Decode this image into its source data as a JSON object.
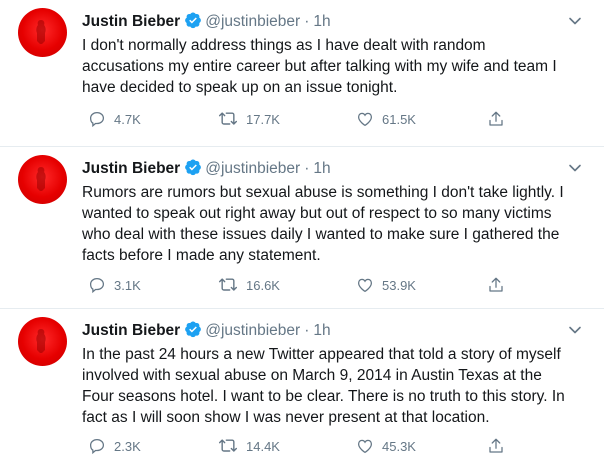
{
  "tweets": [
    {
      "name": "Justin Bieber",
      "handle": "@justinbieber",
      "separator": "·",
      "time": "1h",
      "text": "I don't normally address things as I have dealt with random\naccusations my entire career but after talking with my wife and team I\nhave decided to speak up on an issue tonight.",
      "replies": "4.7K",
      "retweets": "17.7K",
      "likes": "61.5K"
    },
    {
      "name": "Justin Bieber",
      "handle": "@justinbieber",
      "separator": "·",
      "time": "1h",
      "text": "Rumors are rumors but sexual abuse is something I don't take lightly. I\nwanted to speak out right away but out of respect to so many victims\nwho deal with these issues daily I wanted to make sure I gathered the\nfacts before I made any statement.",
      "replies": "3.1K",
      "retweets": "16.6K",
      "likes": "53.9K"
    },
    {
      "name": "Justin Bieber",
      "handle": "@justinbieber",
      "separator": "·",
      "time": "1h",
      "text": "In the past 24 hours a new Twitter appeared that told a story of myself\ninvolved with sexual abuse on March 9, 2014 in Austin Texas at the\nFour seasons hotel. I want to be clear. There is no truth to this story. In\nfact as I will soon show I was never present at that location.",
      "replies": "2.3K",
      "retweets": "14.4K",
      "likes": "45.3K"
    }
  ],
  "colors": {
    "text": "#14171a",
    "muted": "#657786",
    "verified": "#1da1f2",
    "avatar": "#e60000",
    "divider": "#e6ecf0"
  },
  "icons": {
    "verified": "verified-badge-icon",
    "more": "chevron-down-icon",
    "reply": "reply-icon",
    "retweet": "retweet-icon",
    "like": "heart-icon",
    "share": "share-icon"
  }
}
